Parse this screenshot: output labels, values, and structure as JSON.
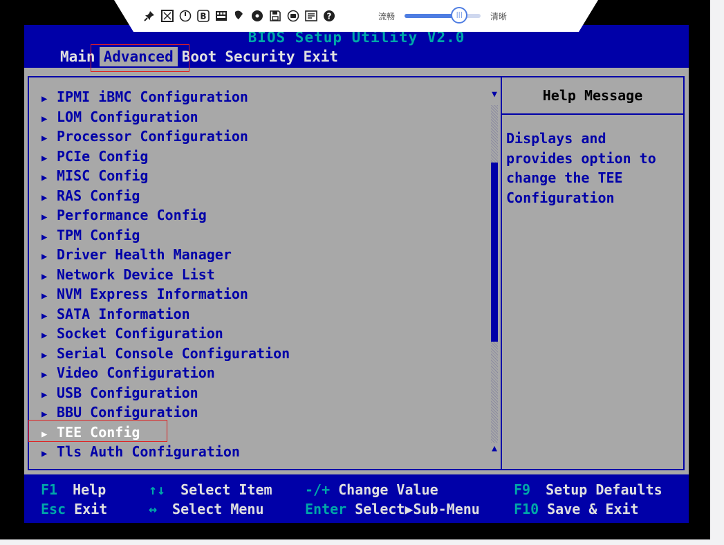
{
  "toolbar": {
    "icons": [
      "pin-icon",
      "fit-screen-icon",
      "power-icon",
      "bold-b-icon",
      "keyboard-icon",
      "mouse-icon",
      "disc-icon",
      "save-icon",
      "record-icon",
      "screenshot-icon",
      "help-icon"
    ],
    "fluency_label": "流畅",
    "clarity_label": "清晰",
    "quality_slider_level": 0.72
  },
  "bios": {
    "title": "BIOS Setup Utility V2.0",
    "menu": [
      {
        "label": "Main",
        "active": false
      },
      {
        "label": "Advanced",
        "active": true
      },
      {
        "label": "Boot",
        "active": false
      },
      {
        "label": "Security",
        "active": false
      },
      {
        "label": "Exit",
        "active": false
      }
    ],
    "items": [
      "IPMI iBMC Configuration",
      "LOM Configuration",
      "Processor Configuration",
      "PCIe Config",
      "MISC Config",
      "RAS Config",
      "Performance Config",
      "TPM Config",
      "Driver Health Manager",
      "Network Device List",
      "NVM Express Information",
      "SATA Information",
      "Socket Configuration",
      "Serial Console Configuration",
      "Video Configuration",
      "USB Configuration",
      "BBU Configuration",
      "TEE Config",
      "Tls Auth Configuration"
    ],
    "selected_item": "TEE Config",
    "help_title": "Help Message",
    "help_text": "Displays and\nprovides option to\nchange the TEE\nConfiguration",
    "scroll_thumb_start": 0.17,
    "scroll_thumb_end": 0.7,
    "footer": [
      {
        "key": "F1",
        "desc": "Help"
      },
      {
        "key": "↑↓",
        "desc": "Select Item"
      },
      {
        "key": "-/+",
        "desc": "Change Value"
      },
      {
        "key": "F9",
        "desc": "Setup Defaults"
      },
      {
        "key": "Esc",
        "desc": "Exit"
      },
      {
        "key": "↔",
        "desc": "Select Menu"
      },
      {
        "key": "Enter",
        "desc": "Select▶Sub-Menu"
      },
      {
        "key": "F10",
        "desc": "Save & Exit"
      }
    ]
  }
}
